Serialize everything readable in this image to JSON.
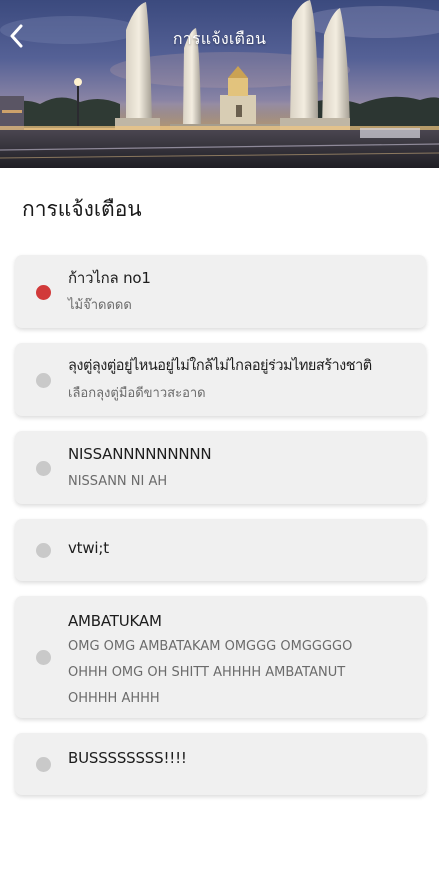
{
  "header": {
    "title": "การแจ้งเตือน",
    "back_icon": "chevron-left-icon"
  },
  "section_title": "การแจ้งเตือน",
  "colors": {
    "unread_dot": "#d13a3a",
    "read_dot": "#c9c9c9",
    "card_bg": "#f0f0f0"
  },
  "notifications": [
    {
      "title": "ก้าวไกล no1",
      "body": "ไม้จ๊าดดดด",
      "unread": true
    },
    {
      "title": "ลุงตู่ลุงตู่อยู่ไหนอยู่ไม่ใกล้ไม่ไกลอยู่ร่วมไทยสร้างชาติ",
      "body": "เลือกลุงตู่มือดีขาวสะอาด",
      "unread": false
    },
    {
      "title": "NISSANNNNNNNNN",
      "body": "NISSANN NI AH",
      "unread": false
    },
    {
      "title": "vtwi;t",
      "body": "",
      "unread": false
    },
    {
      "title": "AMBATUKAM",
      "body": "OMG OMG AMBATAKAM OMGGG OMGGGGO OHHH OMG OH SHITT AHHHH AMBATANUT OHHHH AHHH",
      "unread": false
    },
    {
      "title": "BUSSSSSSSS!!!!",
      "body": "",
      "unread": false
    }
  ]
}
